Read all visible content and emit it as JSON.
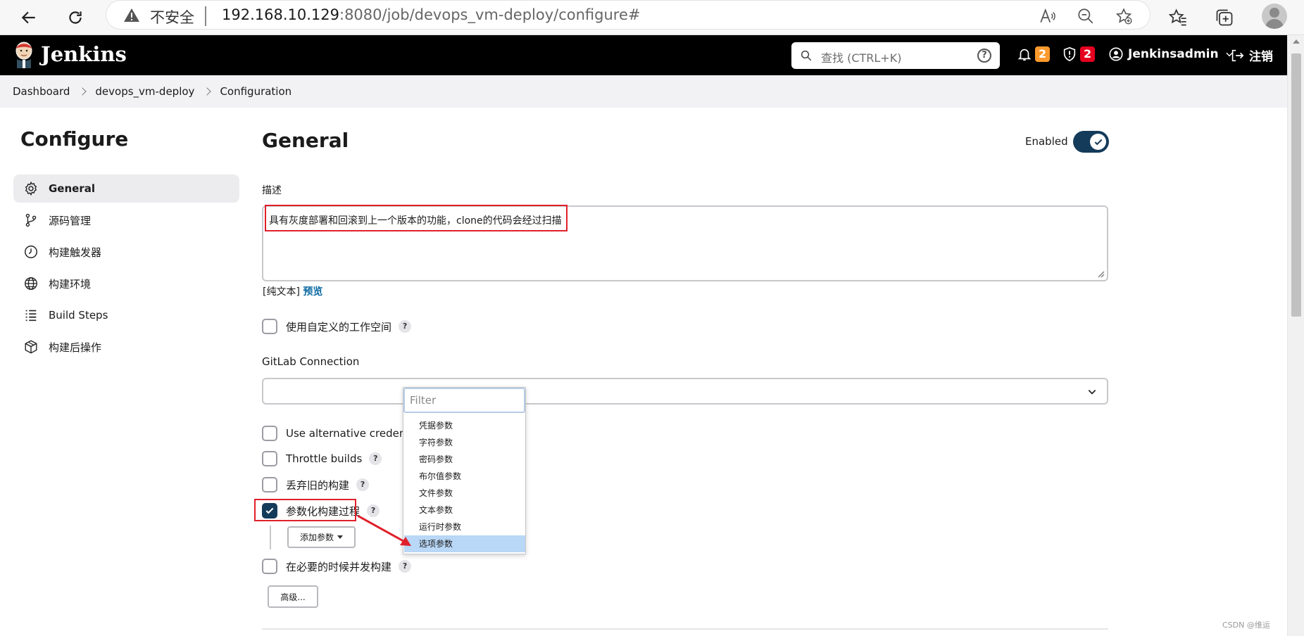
{
  "browser": {
    "insecure_label": "不安全",
    "url_host": "192.168.10.129",
    "url_rest": ":8080/job/devops_vm-deploy/configure#"
  },
  "header": {
    "title": "Jenkins",
    "search_placeholder": "查找 (CTRL+K)",
    "notifications_count": "2",
    "security_count": "2",
    "user": "Jenkinsadmin",
    "logout": "注销"
  },
  "breadcrumb": [
    "Dashboard",
    "devops_vm-deploy",
    "Configuration"
  ],
  "sidebar": {
    "title": "Configure",
    "items": [
      {
        "label": "General",
        "icon": "gear-icon",
        "active": true
      },
      {
        "label": "源码管理",
        "icon": "branch-icon",
        "active": false
      },
      {
        "label": "构建触发器",
        "icon": "clock-icon",
        "active": false
      },
      {
        "label": "构建环境",
        "icon": "globe-icon",
        "active": false
      },
      {
        "label": "Build Steps",
        "icon": "list-icon",
        "active": false
      },
      {
        "label": "构建后操作",
        "icon": "cube-icon",
        "active": false
      }
    ]
  },
  "main": {
    "title": "General",
    "enabled_label": "Enabled",
    "enabled": true,
    "description_label": "描述",
    "description_value": "具有灰度部署和回滚到上一个版本的功能，clone的代码会经过扫描",
    "plain_text": "[纯文本]",
    "preview": "预览",
    "custom_workspace": "使用自定义的工作空间",
    "gitlab_connection_label": "GitLab Connection",
    "gitlab_connection_value": "",
    "alt_credential": "Use alternative credential",
    "throttle_builds": "Throttle builds",
    "discard_old": "丢弃旧的构建",
    "parameterized": "参数化构建过程",
    "parameterized_checked": true,
    "add_param": "添加参数",
    "concurrent": "在必要的时候并发构建",
    "advanced": "高级...",
    "help": "?"
  },
  "popup": {
    "filter_placeholder": "Filter",
    "items": [
      "凭据参数",
      "字符参数",
      "密码参数",
      "布尔值参数",
      "文件参数",
      "文本参数",
      "运行时参数",
      "选项参数"
    ],
    "selected": "选项参数"
  },
  "colors": {
    "accent": "#143b5a",
    "annotation": "#e0202a",
    "selection": "#b9d7f6"
  },
  "watermark": "CSDN @维运"
}
